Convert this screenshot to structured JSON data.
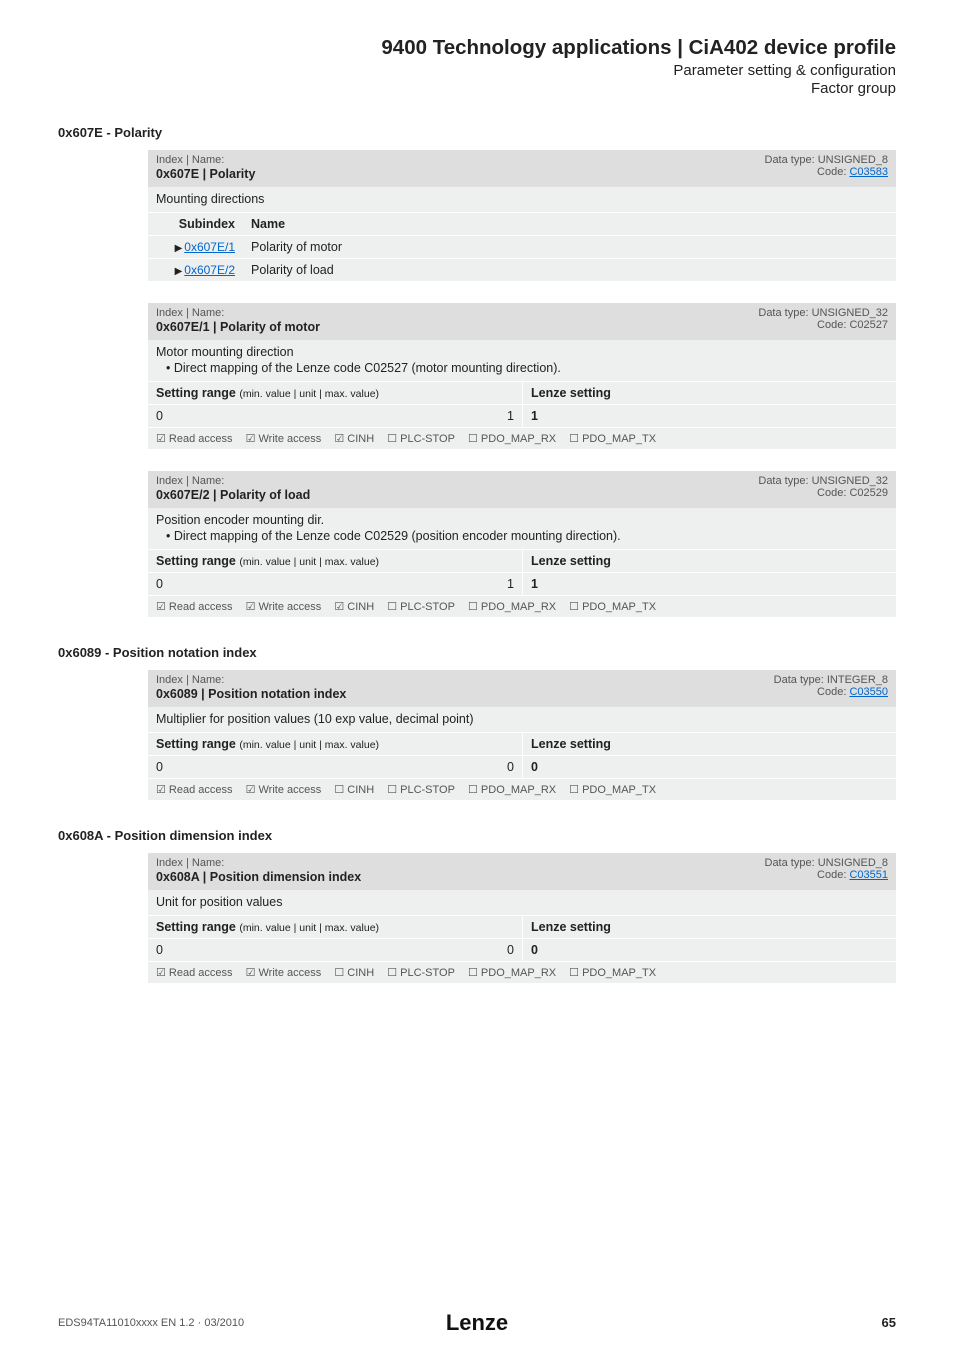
{
  "header": {
    "title": "9400 Technology applications | CiA402 device profile",
    "sub1": "Parameter setting & configuration",
    "sub2": "Factor group"
  },
  "sections": {
    "s1": {
      "heading": "0x607E - Polarity",
      "tables": {
        "t1": {
          "idxLabel": "Index | Name:",
          "idxName": "0x607E | Polarity",
          "dtLabel": "Data type: UNSIGNED_8",
          "codeLabel": "Code:",
          "codeLink": "C03583",
          "desc": "Mounting directions",
          "subHdrC1": "Subindex",
          "subHdrC2": "Name",
          "rows": [
            {
              "link": "0x607E/1",
              "name": "Polarity of motor"
            },
            {
              "link": "0x607E/2",
              "name": "Polarity of load"
            }
          ]
        },
        "t2": {
          "idxLabel": "Index | Name:",
          "idxName": "0x607E/1 | Polarity of motor",
          "dtLabel": "Data type: UNSIGNED_32",
          "codeLabel": "Code: C02527",
          "desc": "Motor mounting direction",
          "bullet": "• Direct mapping of the Lenze code C02527 (motor mounting direction).",
          "setHdrL": "Setting range",
          "setHdrLSub": "(min. value | unit | max. value)",
          "setHdrR": "Lenze setting",
          "setMin": "0",
          "setMax": "1",
          "setVal": "1",
          "flags": {
            "ra": "☑ Read access",
            "wa": "☑ Write access",
            "cinh": "☑ CINH",
            "plc": "☐ PLC-STOP",
            "rx": "☐ PDO_MAP_RX",
            "tx": "☐ PDO_MAP_TX"
          }
        },
        "t3": {
          "idxLabel": "Index | Name:",
          "idxName": "0x607E/2 | Polarity of load",
          "dtLabel": "Data type: UNSIGNED_32",
          "codeLabel": "Code: C02529",
          "desc": "Position encoder mounting dir.",
          "bullet": "• Direct mapping of the Lenze code C02529 (position encoder mounting direction).",
          "setHdrL": "Setting range",
          "setHdrLSub": "(min. value | unit | max. value)",
          "setHdrR": "Lenze setting",
          "setMin": "0",
          "setMax": "1",
          "setVal": "1",
          "flags": {
            "ra": "☑ Read access",
            "wa": "☑ Write access",
            "cinh": "☑ CINH",
            "plc": "☐ PLC-STOP",
            "rx": "☐ PDO_MAP_RX",
            "tx": "☐ PDO_MAP_TX"
          }
        }
      }
    },
    "s2": {
      "heading": "0x6089 - Position notation index",
      "table": {
        "idxLabel": "Index | Name:",
        "idxName": "0x6089 | Position notation index",
        "dtLabel": "Data type: INTEGER_8",
        "codeLabel": "Code:",
        "codeLink": "C03550",
        "desc": "Multiplier for position values (10 exp value, decimal point)",
        "setHdrL": "Setting range",
        "setHdrLSub": "(min. value | unit | max. value)",
        "setHdrR": "Lenze setting",
        "setMin": "0",
        "setMax": "0",
        "setVal": "0",
        "flags": {
          "ra": "☑ Read access",
          "wa": "☑ Write access",
          "cinh": "☐ CINH",
          "plc": "☐ PLC-STOP",
          "rx": "☐ PDO_MAP_RX",
          "tx": "☐ PDO_MAP_TX"
        }
      }
    },
    "s3": {
      "heading": "0x608A - Position dimension index",
      "table": {
        "idxLabel": "Index | Name:",
        "idxName": "0x608A | Position dimension index",
        "dtLabel": "Data type: UNSIGNED_8",
        "codeLabel": "Code:",
        "codeLink": "C03551",
        "desc": "Unit for position values",
        "setHdrL": "Setting range",
        "setHdrLSub": "(min. value | unit | max. value)",
        "setHdrR": "Lenze setting",
        "setMin": "0",
        "setMax": "0",
        "setVal": "0",
        "flags": {
          "ra": "☑ Read access",
          "wa": "☑ Write access",
          "cinh": "☐ CINH",
          "plc": "☐ PLC-STOP",
          "rx": "☐ PDO_MAP_RX",
          "tx": "☐ PDO_MAP_TX"
        }
      }
    }
  },
  "footer": {
    "left": "EDS94TA11010xxxx EN 1.2 · 03/2010",
    "logo": "Lenze",
    "right": "65"
  }
}
